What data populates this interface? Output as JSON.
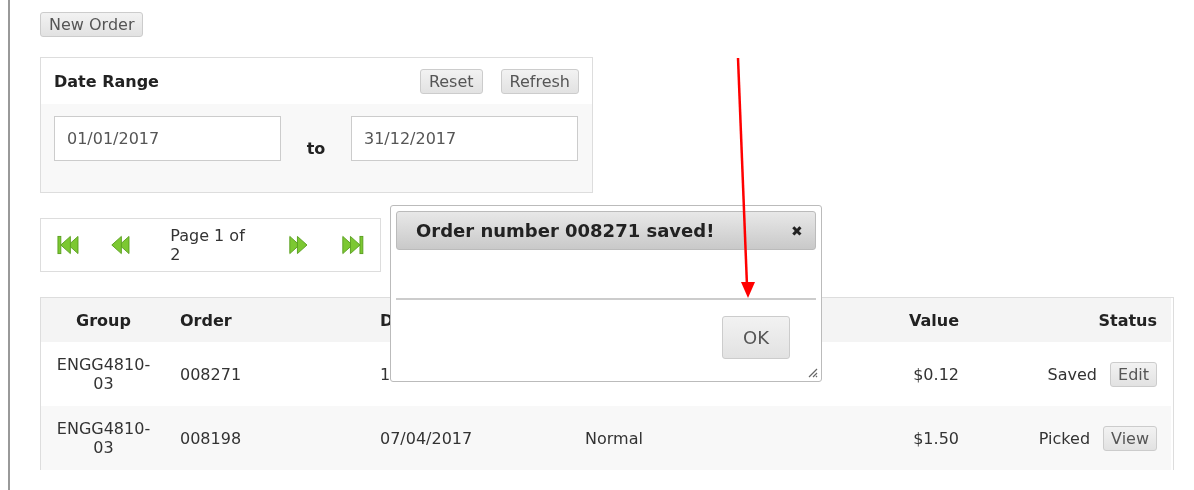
{
  "toolbar": {
    "new_order": "New Order"
  },
  "date_range": {
    "title": "Date Range",
    "reset": "Reset",
    "refresh": "Refresh",
    "from": "01/01/2017",
    "separator": "to",
    "to": "31/12/2017"
  },
  "pager": {
    "label": "Page 1 of 2"
  },
  "table": {
    "columns": [
      "Group",
      "Order",
      "D",
      "",
      "Value",
      "Status"
    ],
    "rows": [
      {
        "group": "ENGG4810-03",
        "order": "008271",
        "date": "1",
        "column_4": "",
        "value": "$0.12",
        "status": "Saved",
        "action": "Edit"
      },
      {
        "group": "ENGG4810-03",
        "order": "008198",
        "date": "07/04/2017",
        "column_4": "Normal",
        "value": "$1.50",
        "status": "Picked",
        "action": "View"
      }
    ]
  },
  "dialog": {
    "title": "Order number 008271 saved!",
    "close": "✖",
    "ok": "OK"
  }
}
